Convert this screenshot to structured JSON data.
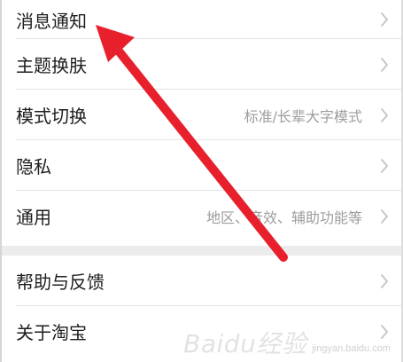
{
  "settings_group_1": [
    {
      "label": "消息通知",
      "value": ""
    },
    {
      "label": "主题换肤",
      "value": ""
    },
    {
      "label": "模式切换",
      "value": "标准/长辈大字模式"
    },
    {
      "label": "隐私",
      "value": ""
    },
    {
      "label": "通用",
      "value": "地区、音效、辅助功能等"
    }
  ],
  "settings_group_2": [
    {
      "label": "帮助与反馈",
      "value": ""
    },
    {
      "label": "关于淘宝",
      "value": ""
    }
  ],
  "annotation": {
    "arrow_color": "#e8202c"
  },
  "watermark": {
    "main": "Baidu经验",
    "sub": "jingyan.baidu.com"
  }
}
